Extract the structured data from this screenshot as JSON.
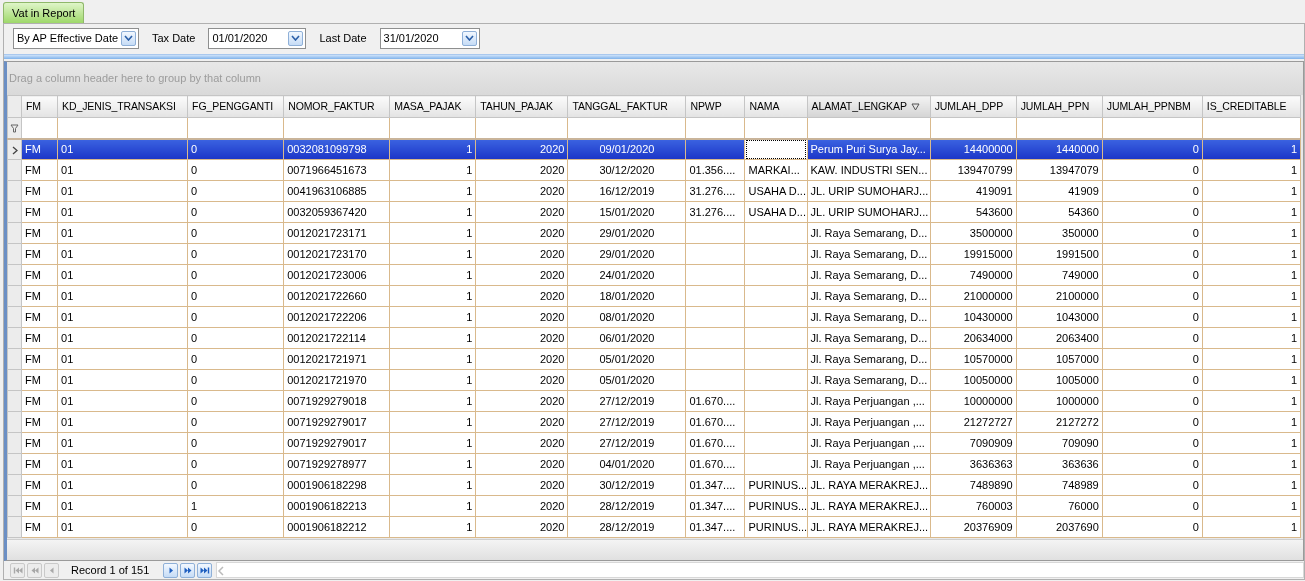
{
  "tabs": [
    {
      "label": "Vat in Report",
      "selected": true
    }
  ],
  "filter_bar": {
    "mode": "By AP Effective Date",
    "tax_date_label": "Tax Date",
    "tax_date": "01/01/2020",
    "last_date_label": "Last Date",
    "last_date": "31/01/2020"
  },
  "grid": {
    "group_panel_hint": "Drag a column header here to group by that column",
    "columns": [
      {
        "label": "FM",
        "kind": "text",
        "sorted": false
      },
      {
        "label": "KD_JENIS_TRANSAKSI",
        "kind": "text",
        "sorted": false
      },
      {
        "label": "FG_PENGGANTI",
        "kind": "text",
        "sorted": false
      },
      {
        "label": "NOMOR_FAKTUR",
        "kind": "text",
        "sorted": false
      },
      {
        "label": "MASA_PAJAK",
        "kind": "number",
        "sorted": false
      },
      {
        "label": "TAHUN_PAJAK",
        "kind": "number",
        "sorted": false
      },
      {
        "label": "TANGGAL_FAKTUR",
        "kind": "date",
        "sorted": false
      },
      {
        "label": "NPWP",
        "kind": "text",
        "sorted": false
      },
      {
        "label": "NAMA",
        "kind": "text",
        "sorted": false
      },
      {
        "label": "ALAMAT_LENGKAP",
        "kind": "text",
        "sorted": true
      },
      {
        "label": "JUMLAH_DPP",
        "kind": "number",
        "sorted": false
      },
      {
        "label": "JUMLAH_PPN",
        "kind": "number",
        "sorted": false
      },
      {
        "label": "JUMLAH_PPNBM",
        "kind": "number",
        "sorted": false
      },
      {
        "label": "IS_CREDITABLE",
        "kind": "number",
        "sorted": false
      }
    ],
    "rows": [
      {
        "selected": true,
        "cells": [
          "FM",
          "01",
          "0",
          "0032081099798",
          "1",
          "2020",
          "09/01/2020",
          "",
          "",
          "Perum Puri Surya Jay...",
          "14400000",
          "1440000",
          "0",
          "1"
        ]
      },
      {
        "selected": false,
        "cells": [
          "FM",
          "01",
          "0",
          "0071966451673",
          "1",
          "2020",
          "30/12/2020",
          "01.356....",
          "MARKAI...",
          "KAW. INDUSTRI SEN...",
          "139470799",
          "13947079",
          "0",
          "1"
        ]
      },
      {
        "selected": false,
        "cells": [
          "FM",
          "01",
          "0",
          "0041963106885",
          "1",
          "2020",
          "16/12/2019",
          "31.276....",
          "USAHA D...",
          "JL. URIP SUMOHARJ...",
          "419091",
          "41909",
          "0",
          "1"
        ]
      },
      {
        "selected": false,
        "cells": [
          "FM",
          "01",
          "0",
          "0032059367420",
          "1",
          "2020",
          "15/01/2020",
          "31.276....",
          "USAHA D...",
          "JL. URIP SUMOHARJ...",
          "543600",
          "54360",
          "0",
          "1"
        ]
      },
      {
        "selected": false,
        "cells": [
          "FM",
          "01",
          "0",
          "0012021723171",
          "1",
          "2020",
          "29/01/2020",
          "",
          "",
          "Jl. Raya Semarang, D...",
          "3500000",
          "350000",
          "0",
          "1"
        ]
      },
      {
        "selected": false,
        "cells": [
          "FM",
          "01",
          "0",
          "0012021723170",
          "1",
          "2020",
          "29/01/2020",
          "",
          "",
          "Jl. Raya Semarang, D...",
          "19915000",
          "1991500",
          "0",
          "1"
        ]
      },
      {
        "selected": false,
        "cells": [
          "FM",
          "01",
          "0",
          "0012021723006",
          "1",
          "2020",
          "24/01/2020",
          "",
          "",
          "Jl. Raya Semarang, D...",
          "7490000",
          "749000",
          "0",
          "1"
        ]
      },
      {
        "selected": false,
        "cells": [
          "FM",
          "01",
          "0",
          "0012021722660",
          "1",
          "2020",
          "18/01/2020",
          "",
          "",
          "Jl. Raya Semarang, D...",
          "21000000",
          "2100000",
          "0",
          "1"
        ]
      },
      {
        "selected": false,
        "cells": [
          "FM",
          "01",
          "0",
          "0012021722206",
          "1",
          "2020",
          "08/01/2020",
          "",
          "",
          "Jl. Raya Semarang, D...",
          "10430000",
          "1043000",
          "0",
          "1"
        ]
      },
      {
        "selected": false,
        "cells": [
          "FM",
          "01",
          "0",
          "0012021722114",
          "1",
          "2020",
          "06/01/2020",
          "",
          "",
          "Jl. Raya Semarang, D...",
          "20634000",
          "2063400",
          "0",
          "1"
        ]
      },
      {
        "selected": false,
        "cells": [
          "FM",
          "01",
          "0",
          "0012021721971",
          "1",
          "2020",
          "05/01/2020",
          "",
          "",
          "Jl. Raya Semarang, D...",
          "10570000",
          "1057000",
          "0",
          "1"
        ]
      },
      {
        "selected": false,
        "cells": [
          "FM",
          "01",
          "0",
          "0012021721970",
          "1",
          "2020",
          "05/01/2020",
          "",
          "",
          "Jl. Raya Semarang, D...",
          "10050000",
          "1005000",
          "0",
          "1"
        ]
      },
      {
        "selected": false,
        "cells": [
          "FM",
          "01",
          "0",
          "0071929279018",
          "1",
          "2020",
          "27/12/2019",
          "01.670....",
          "",
          "Jl. Raya Perjuangan ,...",
          "10000000",
          "1000000",
          "0",
          "1"
        ]
      },
      {
        "selected": false,
        "cells": [
          "FM",
          "01",
          "0",
          "0071929279017",
          "1",
          "2020",
          "27/12/2019",
          "01.670....",
          "",
          "Jl. Raya Perjuangan ,...",
          "21272727",
          "2127272",
          "0",
          "1"
        ]
      },
      {
        "selected": false,
        "cells": [
          "FM",
          "01",
          "0",
          "0071929279017",
          "1",
          "2020",
          "27/12/2019",
          "01.670....",
          "",
          "Jl. Raya Perjuangan ,...",
          "7090909",
          "709090",
          "0",
          "1"
        ]
      },
      {
        "selected": false,
        "cells": [
          "FM",
          "01",
          "0",
          "0071929278977",
          "1",
          "2020",
          "04/01/2020",
          "01.670....",
          "",
          "Jl. Raya Perjuangan ,...",
          "3636363",
          "363636",
          "0",
          "1"
        ]
      },
      {
        "selected": false,
        "cells": [
          "FM",
          "01",
          "0",
          "0001906182298",
          "1",
          "2020",
          "30/12/2019",
          "01.347....",
          "PURINUS...",
          "JL. RAYA MERAKREJ...",
          "7489890",
          "748989",
          "0",
          "1"
        ]
      },
      {
        "selected": false,
        "cells": [
          "FM",
          "01",
          "1",
          "0001906182213",
          "1",
          "2020",
          "28/12/2019",
          "01.347....",
          "PURINUS...",
          "JL. RAYA MERAKREJ...",
          "760003",
          "76000",
          "0",
          "1"
        ]
      },
      {
        "selected": false,
        "cells": [
          "FM",
          "01",
          "0",
          "0001906182212",
          "1",
          "2020",
          "28/12/2019",
          "01.347....",
          "PURINUS...",
          "JL. RAYA MERAKREJ...",
          "20376909",
          "2037690",
          "0",
          "1"
        ]
      }
    ]
  },
  "navigator": {
    "record_text": "Record 1 of 151",
    "buttons": [
      {
        "kind": "first",
        "disabled": true
      },
      {
        "kind": "prev_page",
        "disabled": true
      },
      {
        "kind": "prev",
        "disabled": true
      },
      {
        "kind": "next",
        "disabled": false
      },
      {
        "kind": "next_page",
        "disabled": false
      },
      {
        "kind": "last",
        "disabled": false
      }
    ]
  }
}
